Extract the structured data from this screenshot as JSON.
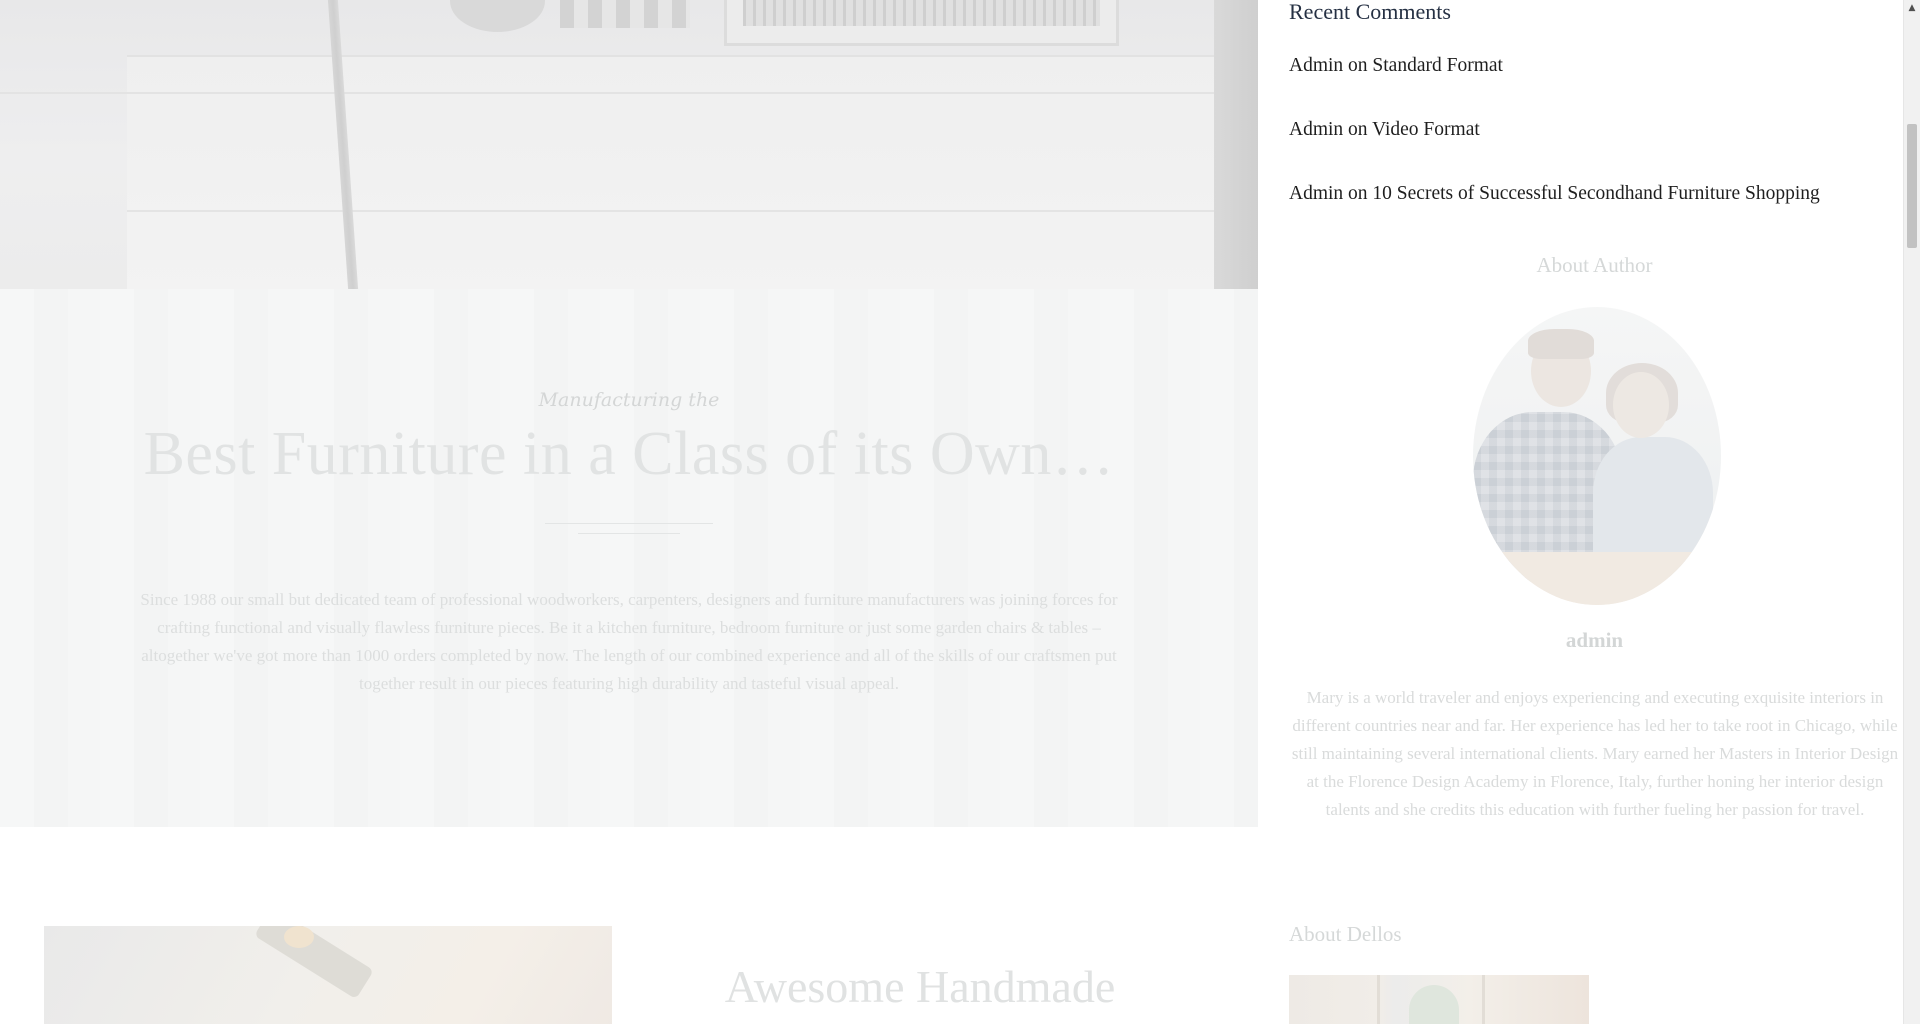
{
  "feature": {
    "subtitle": "Manufacturing the",
    "title": "Best Furniture in a Class of its Own…",
    "body": "Since 1988 our small but dedicated team of professional woodworkers, carpenters, designers and furniture manufacturers was joining forces for crafting functional and visually flawless furniture pieces. Be it a kitchen furniture, bedroom furniture or just some garden chairs & tables – altogether we've got more than 1000 orders completed by now. The length of our combined experience and all of the skills of our craftsmen put together result in our pieces featuring high durability and tasteful visual appeal."
  },
  "work": {
    "title": "Awesome Handmade"
  },
  "sidebar": {
    "recent_comments": {
      "title": "Recent Comments",
      "items": [
        {
          "author": "Admin",
          "sep": " on ",
          "post": "Standard Format"
        },
        {
          "author": "Admin",
          "sep": " on ",
          "post": "Video Format"
        },
        {
          "author": "Admin",
          "sep": " on ",
          "post": "10 Secrets of Successful Secondhand Furniture Shopping"
        }
      ]
    },
    "about_author": {
      "title": "About Author",
      "name": "admin",
      "bio": "Mary is a world traveler and enjoys experiencing and executing exquisite interiors in different countries near and far. Her experience has led her to take root in Chicago, while still maintaining several international clients. Mary earned her Masters in Interior Design at the Florence Design Academy in Florence, Italy, further honing her interior design talents and she credits this education with further fueling her passion for travel."
    },
    "about_dellos": {
      "title": "About Dellos"
    }
  },
  "scrollbar": {
    "up_arrow": "▲"
  }
}
